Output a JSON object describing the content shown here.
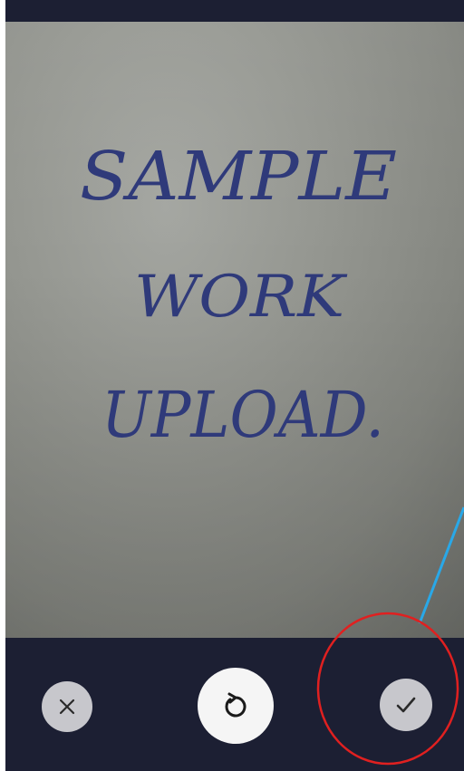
{
  "screen": {
    "theme_bar_color": "#1c1f33"
  },
  "photo": {
    "handwritten_lines": [
      "SAMPLE",
      "WORK",
      "UPLOAD."
    ],
    "ink_color": "#2f3a7a"
  },
  "controls": {
    "cancel_icon": "close-icon",
    "retake_icon": "rotate-icon",
    "confirm_icon": "checkmark-icon"
  },
  "annotation": {
    "circle_color": "#e02020",
    "pointer_line_color": "#29a8e8"
  }
}
